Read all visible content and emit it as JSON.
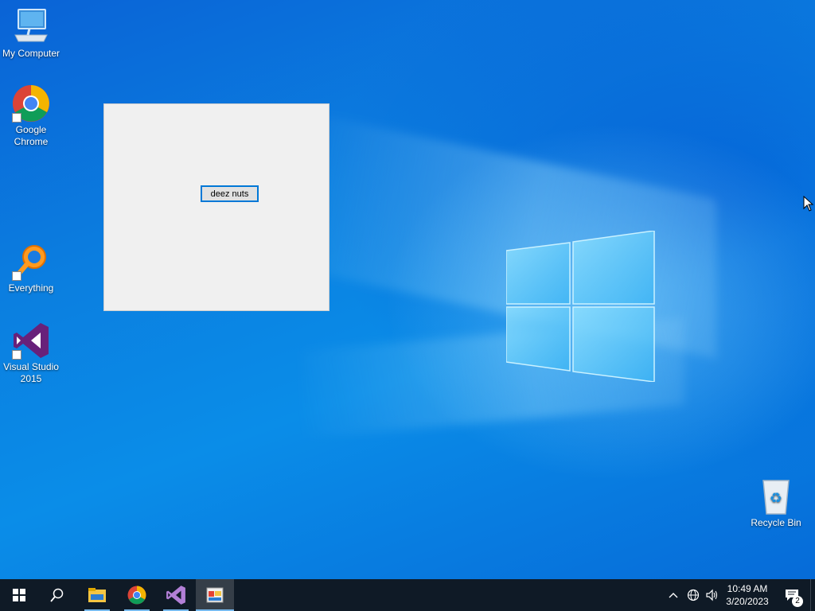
{
  "desktop": {
    "icons": [
      {
        "label": "My Computer"
      },
      {
        "label": "Google Chrome"
      },
      {
        "label": "Everything"
      },
      {
        "label": "Visual Studio 2015"
      },
      {
        "label": "Recycle Bin"
      }
    ]
  },
  "app_window": {
    "button_label": "deez nuts"
  },
  "taskbar": {
    "pinned": [
      "start",
      "search",
      "file-explorer",
      "chrome",
      "visual-studio",
      "app"
    ],
    "clock_time": "10:49 AM",
    "clock_date": "3/20/2023",
    "notification_count": "2"
  },
  "colors": {
    "accent": "#0078d7",
    "taskbar": "#0f1a26",
    "desktop_blue": "#0a7fe0"
  }
}
